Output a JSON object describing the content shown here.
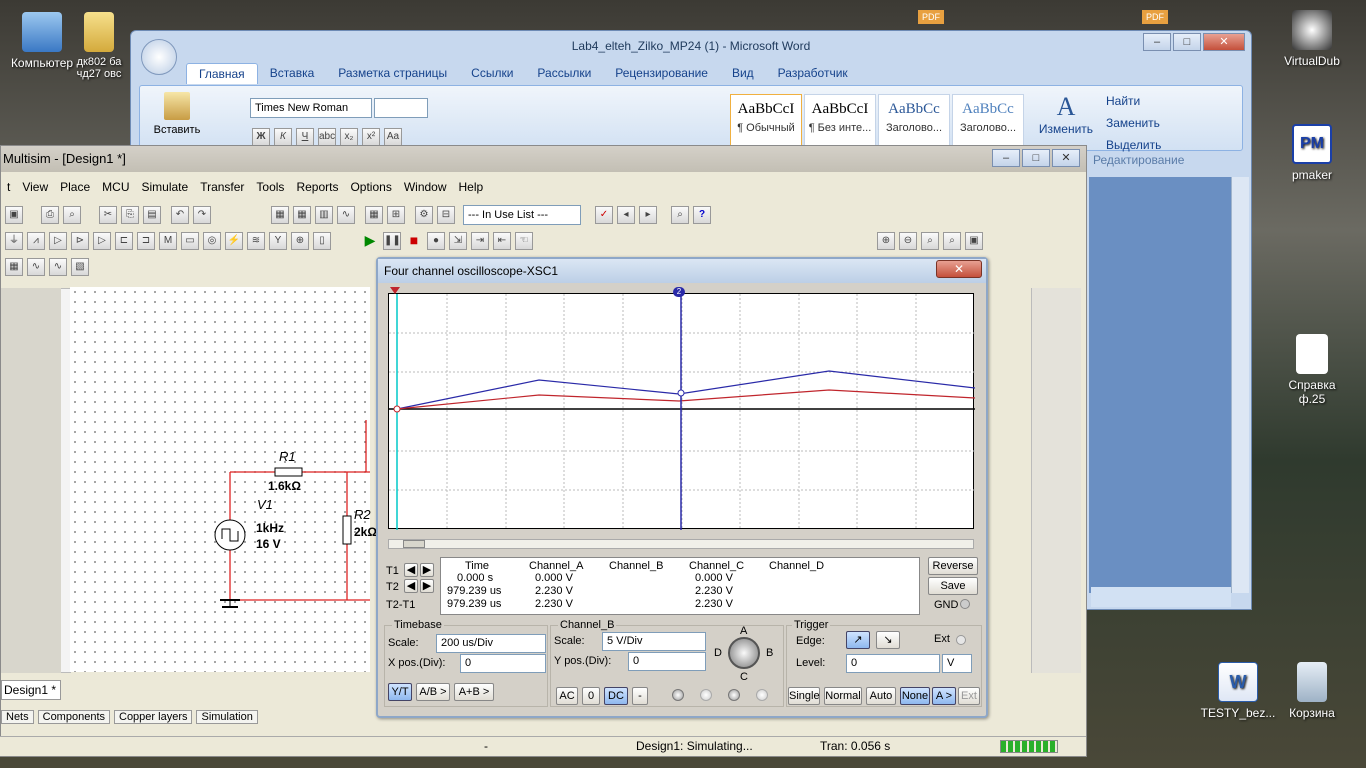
{
  "desktop": {
    "icons": [
      {
        "label": "Компьютер"
      },
      {
        "label": "дк802 ба\nчд27 овс"
      },
      {
        "label": "VirtualDub"
      },
      {
        "label": "pmaker"
      },
      {
        "label": "Справка\nф.25"
      },
      {
        "label": "TESTY_bez..."
      },
      {
        "label": "Корзина"
      }
    ],
    "pdf_label": "PDF"
  },
  "word": {
    "title": "Lab4_elteh_Zilko_MP24 (1) - Microsoft Word",
    "tabs": [
      "Главная",
      "Вставка",
      "Разметка страницы",
      "Ссылки",
      "Рассылки",
      "Рецензирование",
      "Вид",
      "Разработчик"
    ],
    "paste_label": "Вставить",
    "font_name": "Times New Roman",
    "font_size": "",
    "styles": [
      {
        "sample": "AaBbCcI",
        "name": "¶ Обычный"
      },
      {
        "sample": "AaBbCcI",
        "name": "¶ Без инте..."
      },
      {
        "sample": "AaBbCc",
        "name": "Заголово..."
      },
      {
        "sample": "AaBbCc",
        "name": "Заголово..."
      }
    ],
    "change_styles": "Изменить",
    "find": "Найти",
    "replace": "Заменить",
    "select": "Выделить",
    "editing_group": "Редактирование"
  },
  "multisim": {
    "title": "Multisim - [Design1 *]",
    "menu": [
      "t",
      "View",
      "Place",
      "MCU",
      "Simulate",
      "Transfer",
      "Tools",
      "Reports",
      "Options",
      "Window",
      "Help"
    ],
    "in_use_list": "--- In Use List ---",
    "doc_tab": "Design1 *",
    "bottom_tabs": [
      "Nets",
      "Components",
      "Copper layers",
      "Simulation"
    ],
    "status_dash": "-",
    "status_sim": "Design1: Simulating...",
    "status_tran": "Tran: 0.056 s",
    "circuit": {
      "r1_name": "R1",
      "r1_value": "1.6kΩ",
      "v1_name": "V1",
      "v1_freq": "1kHz",
      "v1_amp": "16 V",
      "r2_name": "R2",
      "r2_value": "2kΩ"
    }
  },
  "oscilloscope": {
    "title": "Four channel oscilloscope-XSC1",
    "close": "✕",
    "readout": {
      "headers": [
        "Time",
        "Channel_A",
        "Channel_B",
        "Channel_C",
        "Channel_D"
      ],
      "rows": [
        {
          "label": "T1",
          "time": "0.000 s",
          "a": "0.000 V",
          "b": "",
          "c": "0.000 V",
          "d": ""
        },
        {
          "label": "T2",
          "time": "979.239 us",
          "a": "2.230 V",
          "b": "",
          "c": "2.230 V",
          "d": ""
        },
        {
          "label": "T2-T1",
          "time": "979.239 us",
          "a": "2.230 V",
          "b": "",
          "c": "2.230 V",
          "d": ""
        }
      ]
    },
    "reverse": "Reverse",
    "save": "Save",
    "gnd": "GND",
    "timebase": {
      "title": "Timebase",
      "scale_label": "Scale:",
      "scale": "200 us/Div",
      "xpos_label": "X pos.(Div):",
      "xpos": "0",
      "modes": [
        "Y/T",
        "A/B >",
        "A+B >"
      ]
    },
    "channel": {
      "title": "Channel_B",
      "scale_label": "Scale:",
      "scale": "5  V/Div",
      "ypos_label": "Y pos.(Div):",
      "ypos": "0",
      "coupling": [
        "AC",
        "0",
        "DC",
        "-"
      ],
      "knob": [
        "A",
        "B",
        "C",
        "D"
      ]
    },
    "trigger": {
      "title": "Trigger",
      "edge_label": "Edge:",
      "ext": "Ext",
      "level_label": "Level:",
      "level": "0",
      "level_unit": "V",
      "modes": [
        "Single",
        "Normal",
        "Auto",
        "None",
        "A >",
        "Ext"
      ]
    },
    "cursor_t2": "2",
    "colors": {
      "trace_a": "#c0252c",
      "trace_c": "#2a2aa8",
      "cursor1": "#00c8c8",
      "cursor2": "#2a2aa8"
    }
  }
}
